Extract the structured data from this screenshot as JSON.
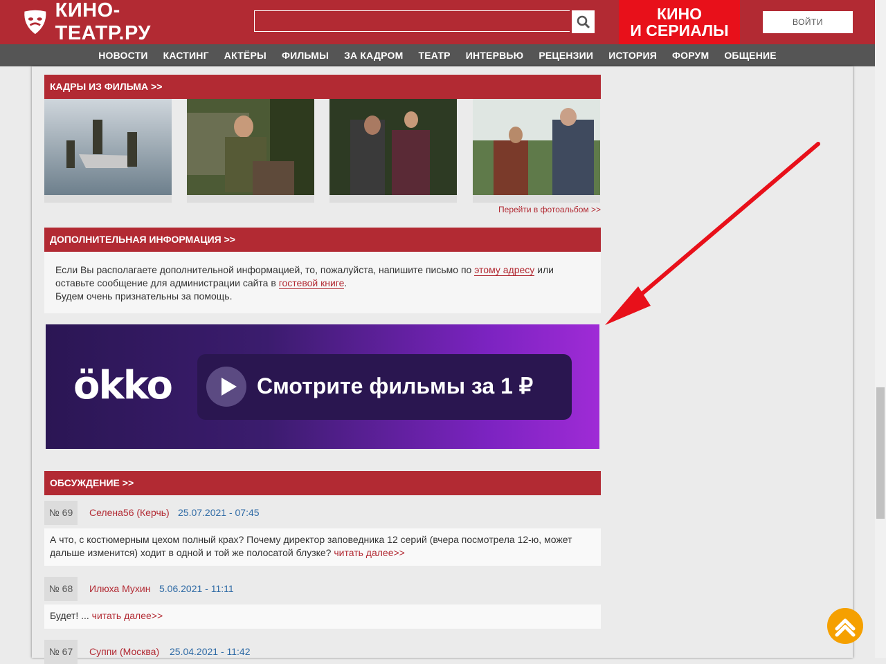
{
  "header": {
    "logo_text": "КИНО-ТЕАТР.РУ",
    "search_placeholder": "",
    "promo_line1": "КИНО",
    "promo_line2": "И СЕРИАЛЫ",
    "login_label": "ВОЙТИ"
  },
  "nav": [
    "НОВОСТИ",
    "КАСТИНГ",
    "АКТЁРЫ",
    "ФИЛЬМЫ",
    "ЗА КАДРОМ",
    "ТЕАТР",
    "ИНТЕРВЬЮ",
    "РЕЦЕНЗИИ",
    "ИСТОРИЯ",
    "ФОРУМ",
    "ОБЩЕНИЕ"
  ],
  "frames": {
    "title": "КАДРЫ ИЗ ФИЛЬМА >>",
    "album_link": "Перейти в фотоальбом >>"
  },
  "info": {
    "title": "ДОПОЛНИТЕЛЬНАЯ ИНФОРМАЦИЯ >>",
    "text1": "Если Вы располагаете дополнительной информацией, то, пожалуйста, напишите письмо по ",
    "link1": "этому адресу",
    "text2": " или",
    "text3": "оставьте сообщение для администрации сайта в ",
    "link2": "гостевой книге",
    "text4": ".",
    "text5": "Будем очень признательны за помощь."
  },
  "banner": {
    "brand": "ökko",
    "cta": "Смотрите фильмы за 1 ₽"
  },
  "discussion": {
    "title": "ОБСУЖДЕНИЕ >>",
    "comments": [
      {
        "num": "№ 69",
        "author": "Селена56 (Керчь)",
        "date": "25.07.2021 - 07:45",
        "text": "А что, с костюмерным цехом полный крах? Почему директор заповедника 12 серий (вчера посмотрела 12-ю, может дальше изменится) ходит в одной и той же полосатой блузке?",
        "more": "читать далее>>"
      },
      {
        "num": "№ 68",
        "author": "Илюха Мухин",
        "date": "5.06.2021 - 11:11",
        "text": "Будет! ...",
        "more": "читать далее>>"
      },
      {
        "num": "№ 67",
        "author": "Суппи (Москва)",
        "date": "25.04.2021 - 11:42"
      }
    ]
  },
  "colors": {
    "brand": "#b22a33",
    "promo": "#e8101a",
    "nav": "#555555",
    "link_date": "#2e6aa5",
    "up_button": "#f5a000"
  }
}
